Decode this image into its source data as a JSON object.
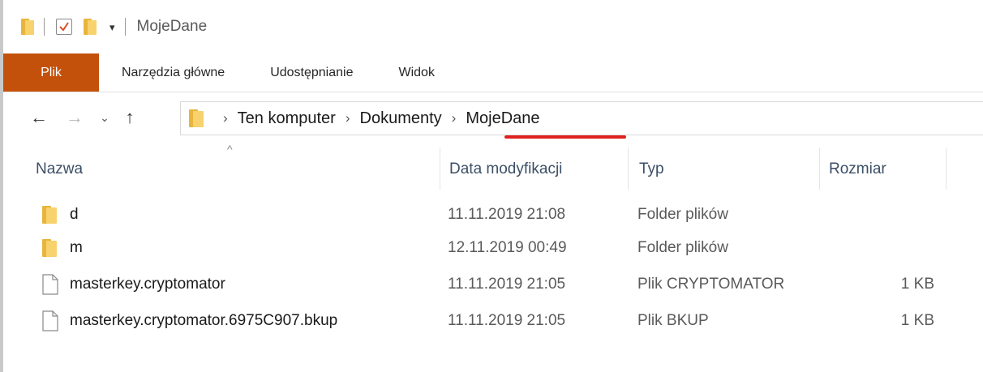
{
  "window": {
    "title": "MojeDane"
  },
  "quick_access": {
    "dropdown_glyph": "▾"
  },
  "ribbon": {
    "file_tab": "Plik",
    "tabs": [
      "Narzędzia główne",
      "Udostępnianie",
      "Widok"
    ]
  },
  "nav": {
    "back_glyph": "←",
    "forward_glyph": "→",
    "recent_glyph": "⌄",
    "up_glyph": "↑"
  },
  "address": {
    "separator": "›",
    "crumbs": [
      "Ten komputer",
      "Dokumenty",
      "MojeDane"
    ]
  },
  "columns": {
    "name": "Nazwa",
    "date": "Data modyfikacji",
    "type": "Typ",
    "size": "Rozmiar",
    "sort_glyph": "^"
  },
  "files": [
    {
      "icon": "folder-icon",
      "name": "d",
      "date": "11.11.2019 21:08",
      "type": "Folder plików",
      "size": ""
    },
    {
      "icon": "folder-icon",
      "name": "m",
      "date": "12.11.2019 00:49",
      "type": "Folder plików",
      "size": ""
    },
    {
      "icon": "file-icon",
      "name": "masterkey.cryptomator",
      "date": "11.11.2019 21:05",
      "type": "Plik CRYPTOMATOR",
      "size": "1 KB"
    },
    {
      "icon": "file-icon",
      "name": "masterkey.cryptomator.6975C907.bkup",
      "date": "11.11.2019 21:05",
      "type": "Plik BKUP",
      "size": "1 KB"
    }
  ],
  "colors": {
    "file_tab": "#c3510b",
    "folder_back": "#e8b53c",
    "folder_front": "#f7d26d",
    "annotation_underline": "#e02020",
    "header_text": "#3b4f66"
  }
}
